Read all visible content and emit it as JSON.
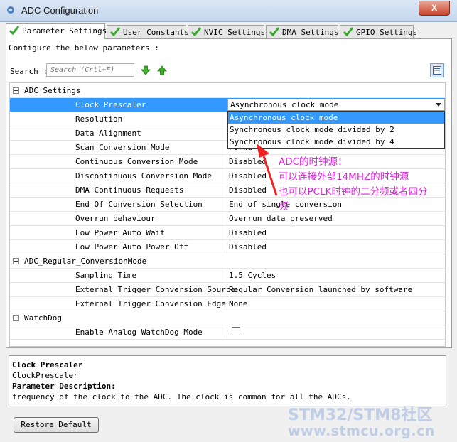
{
  "window": {
    "title": "ADC Configuration",
    "close_label": "X"
  },
  "tabs": [
    {
      "label": "Parameter Settings",
      "active": true
    },
    {
      "label": "User Constants",
      "active": false
    },
    {
      "label": "NVIC Settings",
      "active": false
    },
    {
      "label": "DMA Settings",
      "active": false
    },
    {
      "label": "GPIO Settings",
      "active": false
    }
  ],
  "configure_text": "Configure the below parameters :",
  "search": {
    "label": "Search :",
    "placeholder": "Search (Crtl+F)"
  },
  "groups": {
    "adc_settings": "ADC_Settings",
    "regular": "ADC_Regular_ConversionMode",
    "watchdog": "WatchDog"
  },
  "params": [
    {
      "name": "Clock Prescaler",
      "value": ""
    },
    {
      "name": "Resolution",
      "value": ""
    },
    {
      "name": "Data Alignment",
      "value": ""
    },
    {
      "name": "Scan Conversion Mode",
      "value": "Forward"
    },
    {
      "name": "Continuous Conversion Mode",
      "value": "Disabled"
    },
    {
      "name": "Discontinuous Conversion Mode",
      "value": "Disabled"
    },
    {
      "name": "DMA Continuous Requests",
      "value": "Disabled"
    },
    {
      "name": "End Of Conversion Selection",
      "value": "End of single conversion"
    },
    {
      "name": "Overrun behaviour",
      "value": "Overrun data preserved"
    },
    {
      "name": "Low Power Auto Wait",
      "value": "Disabled"
    },
    {
      "name": "Low Power Auto Power Off",
      "value": "Disabled"
    },
    {
      "name": "Sampling Time",
      "value": "1.5 Cycles"
    },
    {
      "name": "External Trigger Conversion Source",
      "value": "Regular Conversion launched by software"
    },
    {
      "name": "External Trigger Conversion Edge",
      "value": "None"
    },
    {
      "name": "Enable Analog WatchDog Mode",
      "value": ""
    }
  ],
  "dropdown": {
    "selected": "Asynchronous clock mode",
    "options": [
      "Asynchronous clock mode",
      "Synchronous clock mode divided by 2",
      "Synchronous clock mode divided by 4"
    ]
  },
  "annotation": {
    "lines": [
      "ADC的时钟源：",
      "可以连接外部14MHZ的时钟源",
      "也可以PCLK时钟的二分频或者四分",
      "频"
    ],
    "color": "#e01ee0"
  },
  "description": {
    "title": "Clock Prescaler",
    "id": "ClockPrescaler",
    "heading": "Parameter Description:",
    "text": "frequency of the clock to the ADC. The clock is common for all the ADCs."
  },
  "restore_label": "Restore Default",
  "watermark": {
    "line1": "STM32/STM8社区",
    "line2": "www.stmcu.org.cn"
  },
  "colors": {
    "selection": "#3399ff",
    "check_green": "#3aa82c"
  }
}
